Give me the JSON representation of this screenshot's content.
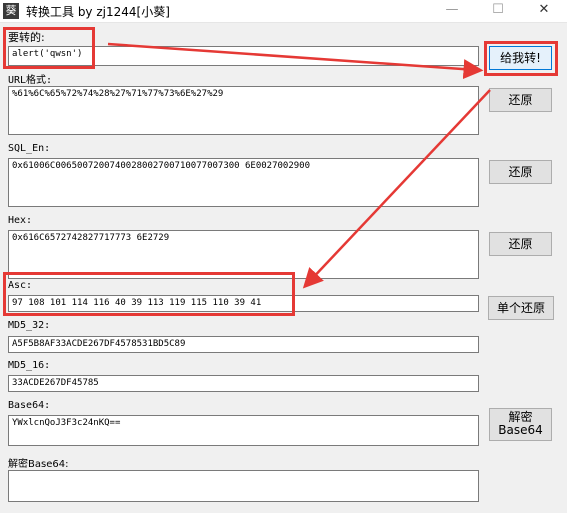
{
  "window": {
    "title": "转换工具 by zj1244[小葵]",
    "icon_glyph": "葵",
    "minimize_glyph": "—",
    "maximize_glyph": "☐",
    "close_glyph": "✕"
  },
  "fields": {
    "input": {
      "label": "要转的:",
      "value": "alert('qwsn')"
    },
    "url": {
      "label": "URL格式:",
      "value": "%61%6C%65%72%74%28%27%71%77%73%6E%27%29"
    },
    "sql_en": {
      "label": "SQL_En:",
      "value": "0x61006C0065007200740028002700710077007300 6E0027002900"
    },
    "hex": {
      "label": "Hex:",
      "value": "0x616C6572742827717773 6E2729"
    },
    "asc": {
      "label": "Asc:",
      "value": "97 108 101 114 116 40 39 113 119 115 110 39 41"
    },
    "md5_32": {
      "label": "MD5_32:",
      "value": "A5F5B8AF33ACDE267DF4578531BD5C89"
    },
    "md5_16": {
      "label": "MD5_16:",
      "value": "33ACDE267DF45785"
    },
    "base64": {
      "label": "Base64:",
      "value": "YWxlcnQoJ3F3c24nKQ=="
    },
    "decode_base64": {
      "label": "解密Base64:",
      "value": ""
    }
  },
  "buttons": {
    "convert": "给我转!",
    "restore_url": "还原",
    "restore_sql": "还原",
    "restore_hex": "还原",
    "restore_asc": "单个还原",
    "decode_base64": "解密 Base64"
  },
  "annotation_color": "#e53935"
}
